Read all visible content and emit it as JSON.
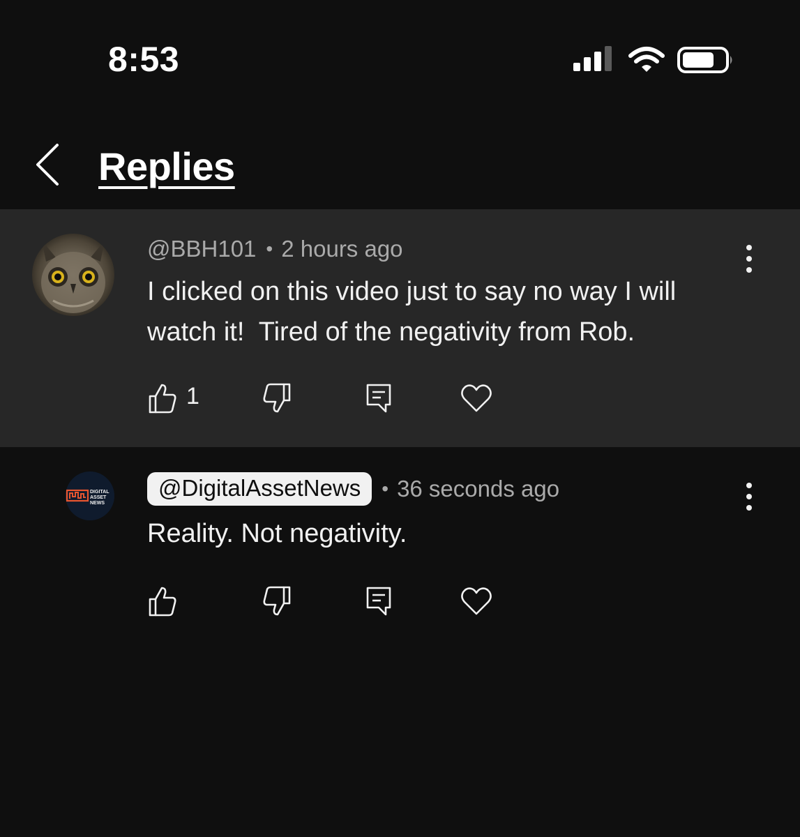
{
  "status_bar": {
    "time": "8:53",
    "icons": [
      "cellular-signal-icon",
      "wifi-icon",
      "battery-icon"
    ]
  },
  "header": {
    "back_icon": "chevron-left-icon",
    "title": "Replies"
  },
  "comments": [
    {
      "handle": "@BBH101",
      "separator": "•",
      "time": "2 hours ago",
      "text": "I clicked on this video just to say no way I will watch it!  Tired of the negativity from Rob.",
      "likes": "1",
      "avatar": "owl-avatar"
    },
    {
      "handle": "@DigitalAssetNews",
      "separator": "•",
      "time": "36 seconds ago",
      "text": "Reality. Not negativity.",
      "likes": "",
      "avatar": "digital-asset-news-logo",
      "logo_text": "DIGITAL ASSET NEWS"
    }
  ],
  "colors": {
    "background": "#0f0f0f",
    "highlight_background": "#272727",
    "primary_text": "#f1f1f1",
    "secondary_text": "#aaaaaa",
    "logo_accent": "#e8552f"
  }
}
